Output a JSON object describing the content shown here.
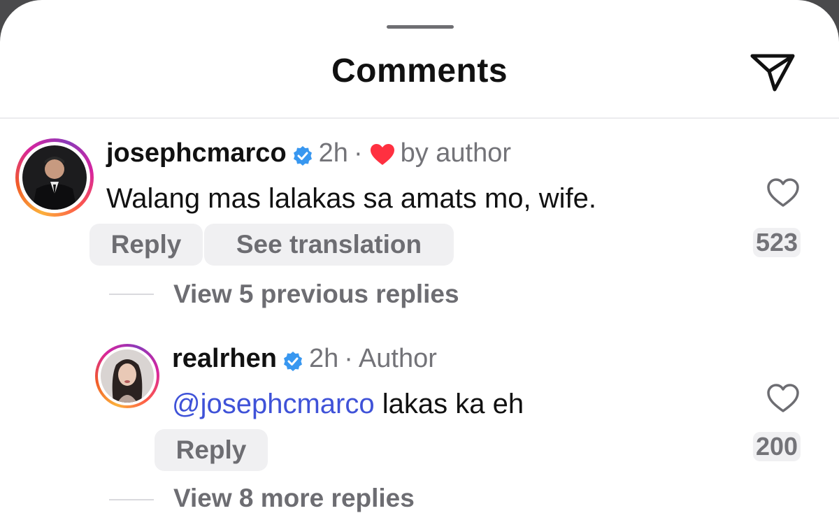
{
  "header": {
    "title": "Comments",
    "send_icon": "paper-plane-icon"
  },
  "comments": [
    {
      "username": "josephcmarco",
      "verified": true,
      "time": "2h",
      "separator": "·",
      "liked_by_author_icon": "heart-filled-icon",
      "liked_by_author_label": "by author",
      "text": "Walang mas lalakas sa amats mo, wife.",
      "actions": {
        "reply": "Reply",
        "translate": "See translation"
      },
      "likes": "523",
      "thread_link": "View 5 previous replies"
    },
    {
      "username": "realrhen",
      "verified": true,
      "time": "2h",
      "separator": "·",
      "role": "Author",
      "mention": "@josephcmarco",
      "text": " lakas ka eh",
      "actions": {
        "reply": "Reply"
      },
      "likes": "200",
      "thread_link": "View 8 more replies"
    }
  ],
  "colors": {
    "accent_verified": "#3897f0",
    "heart_red": "#ff3040",
    "mention_blue": "#3f52d8",
    "muted_text": "#737378"
  }
}
